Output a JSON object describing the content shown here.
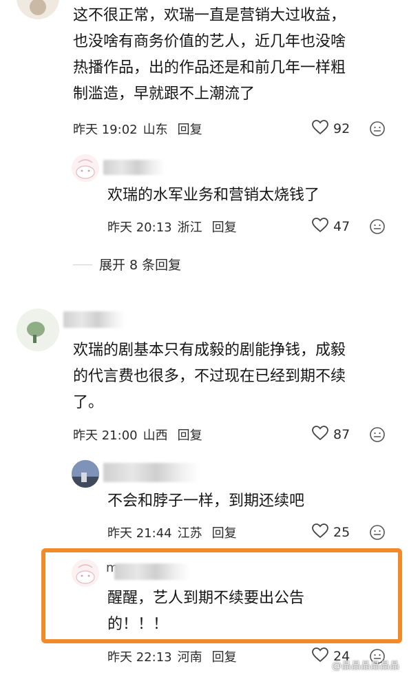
{
  "comments": [
    {
      "text": "这不很正常，欢瑞一直是营销大过收益，也没啥有商务价值的艺人，近几年也没啥热播作品，出的作品还是和前几年一样粗制滥造，早就跟不上潮流了",
      "lines": [
        "这不很正常，欢瑞一直是营销大过收益，",
        "也没啥有商务价值的艺人，近几年也没啥",
        "热播作品，出的作品还是和前几年一样粗",
        "制滥造，早就跟不上潮流了"
      ],
      "time": "昨天 19:02",
      "location": "山东",
      "reply": "回复",
      "likes": "92"
    },
    {
      "text": "欢瑞的水军业务和营销太烧钱了",
      "time": "昨天 20:13",
      "location": "浙江",
      "reply": "回复",
      "likes": "47"
    },
    {
      "expand": "展开 8 条回复"
    },
    {
      "lines": [
        "欢瑞的剧基本只有成毅的剧能挣钱，成毅",
        "的代言费也很多，不过现在已经到期不续",
        "了。"
      ],
      "time": "昨天 21:00",
      "location": "山西",
      "reply": "回复",
      "likes": "87"
    },
    {
      "text": "不会和脖子一样，到期还续吧",
      "time": "昨天 21:44",
      "location": "江苏",
      "reply": "回复",
      "likes": "25"
    },
    {
      "lines": [
        "醒醒，艺人到期不续要出公告",
        "的！！！"
      ],
      "username_partial": "m",
      "time": "昨天 22:13",
      "location": "河南",
      "reply": "回复",
      "likes": "24"
    }
  ],
  "watermark": "@晶晶晶晶晶晶",
  "colors": {
    "highlight": "#f28a2a",
    "text": "#161616"
  },
  "icons": {
    "like": "heart-outline-icon",
    "emoji": "emoji-icon"
  }
}
